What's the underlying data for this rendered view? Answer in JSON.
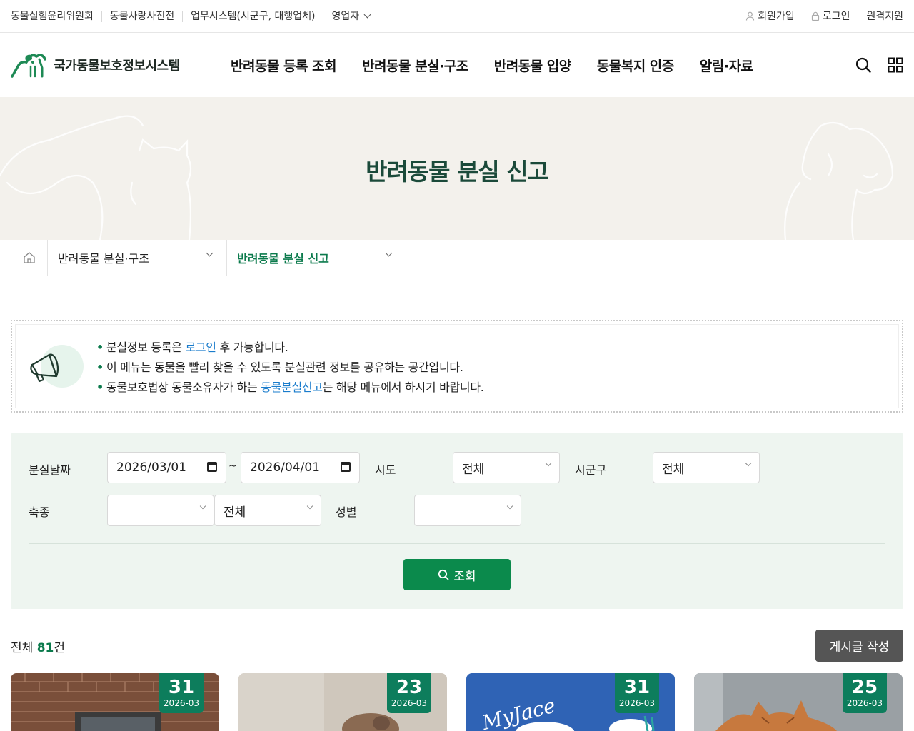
{
  "util": {
    "left": [
      "동물실험윤리위원회",
      "동물사랑사진전",
      "업무시스템(시군구, 대행업체)",
      "영업자"
    ],
    "right": [
      "회원가입",
      "로그인",
      "원격지원"
    ]
  },
  "header": {
    "logo_text": "국가동물보호정보시스템",
    "nav": [
      "반려동물 등록 조회",
      "반려동물 분실·구조",
      "반려동물 입양",
      "동물복지 인증",
      "알림·자료"
    ]
  },
  "hero": {
    "title": "반려동물 분실 신고"
  },
  "breadcrumb": {
    "level1": "반려동물 분실·구조",
    "level2": "반려동물 분실 신고"
  },
  "notice": {
    "line1_pre": "분실정보 등록은 ",
    "line1_link": "로그인",
    "line1_post": " 후 가능합니다.",
    "line2": "이 메뉴는 동물을 빨리 찾을 수 있도록 분실관련 정보를 공유하는 공간입니다.",
    "line3_pre": "동물보호법상 동물소유자가 하는 ",
    "line3_link": "동물분실신고",
    "line3_post": "는 해당 메뉴에서 하시기 바랍니다."
  },
  "search": {
    "date_label": "분실날짜",
    "date_from": "2026/03/01",
    "date_sep": "~",
    "date_to": "2026/04/01",
    "sido_label": "시도",
    "sido_value": "전체",
    "sigungu_label": "시군구",
    "sigungu_value": "전체",
    "species_label": "축종",
    "species_value1": "",
    "species_value2": "전체",
    "gender_label": "성별",
    "gender_value": "",
    "button": "조회"
  },
  "list": {
    "total_prefix": "전체",
    "total_count": "81",
    "total_suffix": "건",
    "write_button": "게시글 작성",
    "cards": [
      {
        "day": "31",
        "ym": "2026-03"
      },
      {
        "day": "23",
        "ym": "2026-03"
      },
      {
        "day": "31",
        "ym": "2026-03",
        "overlay_text": "MyJace"
      },
      {
        "day": "25",
        "ym": "2026-03"
      }
    ]
  },
  "colors": {
    "brand_green": "#0b8a4c",
    "badge_green": "#0d7d5c",
    "hero_bg": "#f3f1ec",
    "link_blue": "#1a7ccc"
  }
}
